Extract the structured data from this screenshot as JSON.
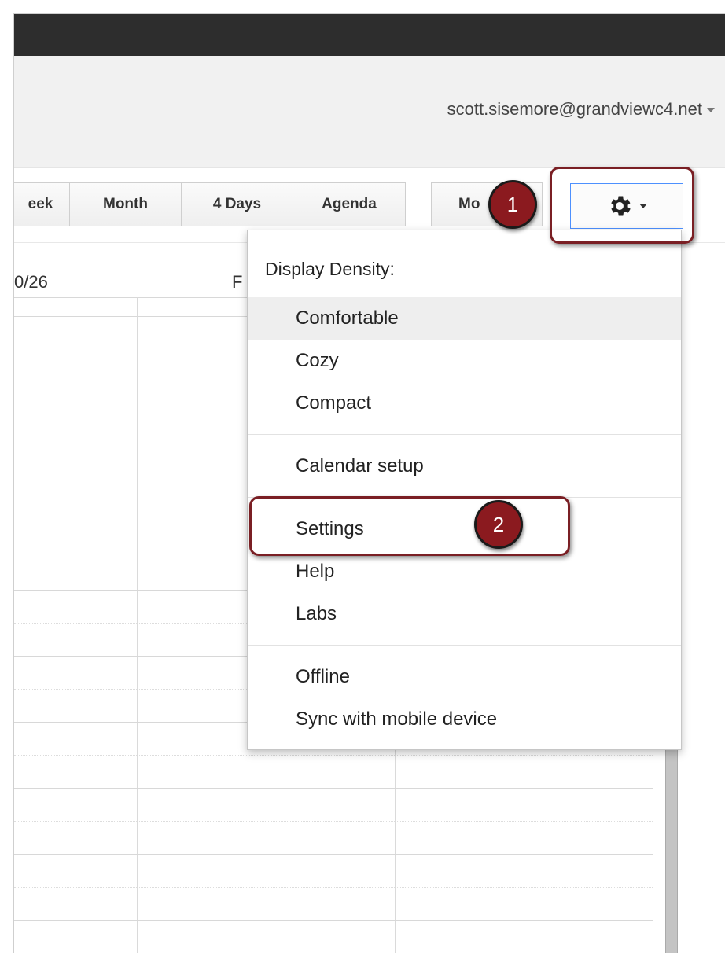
{
  "header": {
    "account_email": "scott.sisemore@grandviewc4.net"
  },
  "toolbar": {
    "week_label": "eek",
    "month_label": "Month",
    "four_days_label": "4 Days",
    "agenda_label": "Agenda",
    "more_label": "Mo"
  },
  "calendar": {
    "date_left": "0/26",
    "day_partial": "F"
  },
  "menu": {
    "section_title": "Display Density:",
    "density_items": [
      "Comfortable",
      "Cozy",
      "Compact"
    ],
    "calendar_setup": "Calendar setup",
    "settings": "Settings",
    "help": "Help",
    "labs": "Labs",
    "offline": "Offline",
    "sync": "Sync with mobile device"
  },
  "annotations": {
    "step1": "1",
    "step2": "2"
  },
  "icons": {
    "settings_button": "gear-icon"
  },
  "colors": {
    "callout": "#7a1f24",
    "badge": "#8b1a1f",
    "focus_border": "#4d90fe"
  }
}
